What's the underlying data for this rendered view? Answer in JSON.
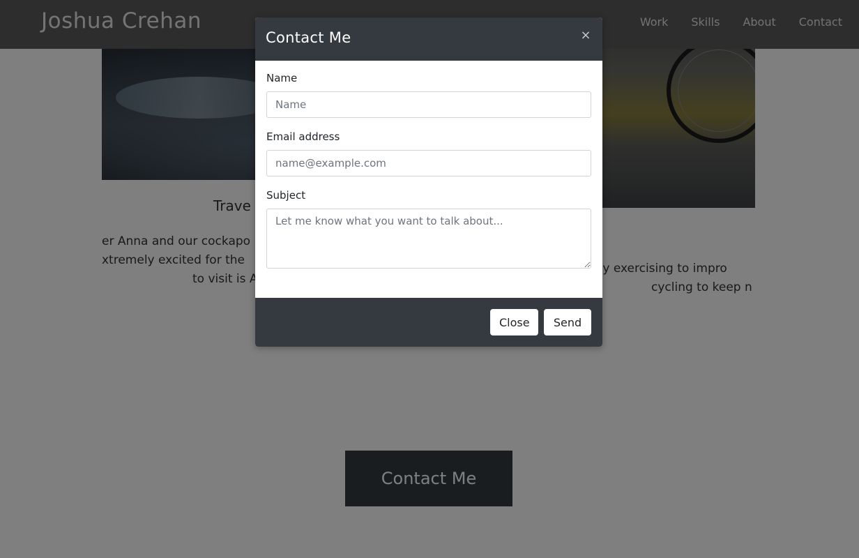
{
  "navbar": {
    "brand": "Joshua Crehan",
    "links": [
      "Work",
      "Skills",
      "About",
      "Contact"
    ]
  },
  "sections": {
    "travel": {
      "heading": "Trave",
      "lines": [
        "er Anna and our cockapo",
        "xtremely excited for the",
        "to visit is A"
      ]
    },
    "cycling": {
      "lines": [
        "enjoy exercising to impro",
        "cycling to keep n"
      ]
    }
  },
  "cta": {
    "label": "Contact Me"
  },
  "modal": {
    "title": "Contact Me",
    "close_icon": "×",
    "fields": {
      "name": {
        "label": "Name",
        "placeholder": "Name",
        "value": ""
      },
      "email": {
        "label": "Email address",
        "placeholder": "name@example.com",
        "value": ""
      },
      "subject": {
        "label": "Subject",
        "placeholder": "Let me know what you want to talk about...",
        "value": ""
      }
    },
    "buttons": {
      "close": "Close",
      "send": "Send"
    }
  },
  "colors": {
    "modal_header": "#343a40",
    "modal_footer": "#343a40",
    "cta_background": "#343a40",
    "backdrop": "rgba(0,0,0,0.5)"
  }
}
